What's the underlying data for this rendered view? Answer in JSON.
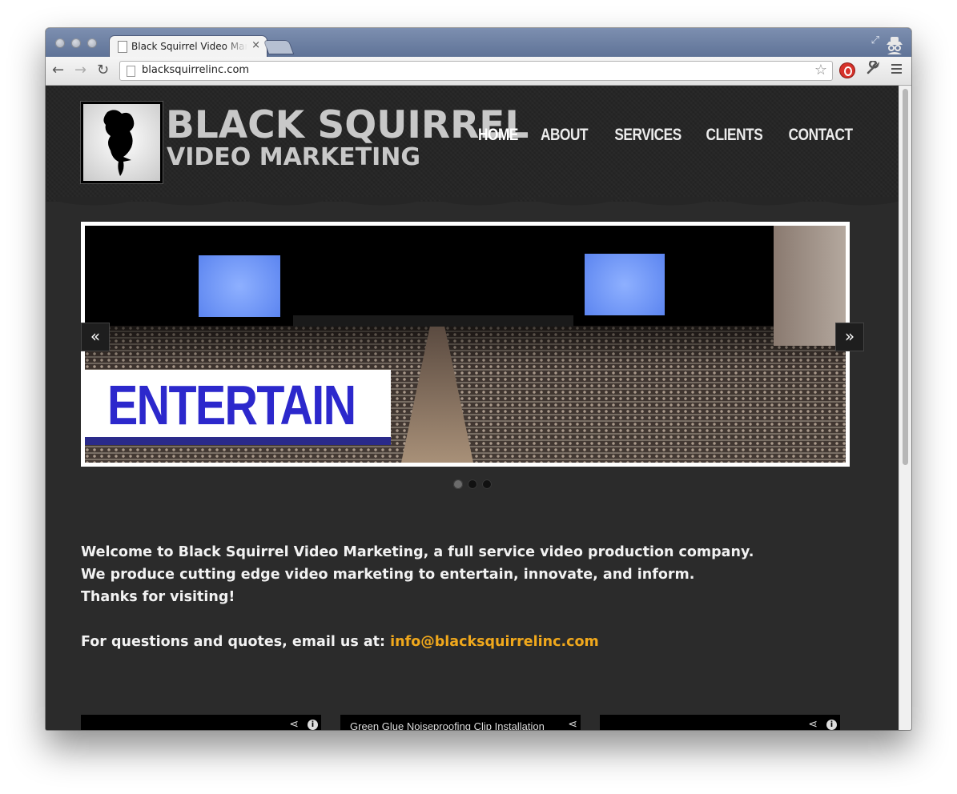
{
  "browser": {
    "tab_title": "Black Squirrel Video Marketing",
    "tab_close": "×",
    "url": "blacksquirrelinc.com",
    "back": "←",
    "forward": "→",
    "reload": "↻",
    "star": "☆",
    "wrench": "🔧",
    "expand": "⤢"
  },
  "site": {
    "logo_line1": "BLACK SQUIRREL",
    "logo_line2": "VIDEO MARKETING",
    "nav": [
      {
        "label": "HOME"
      },
      {
        "label": "ABOUT"
      },
      {
        "label": "SERVICES"
      },
      {
        "label": "CLIENTS"
      },
      {
        "label": "CONTACT"
      }
    ],
    "slider": {
      "caption": "ENTERTAIN",
      "prev": "«",
      "next": "»",
      "slide_count": 3,
      "active_slide": 1
    },
    "intro": {
      "line1": "Welcome to Black Squirrel Video Marketing, a full service video production company.",
      "line2": "We produce cutting edge video marketing to entertain, innovate, and inform.",
      "line3": "Thanks for visiting!",
      "email_prefix": "For questions and quotes, email us at: ",
      "email": "info@blacksquirrelinc.com"
    },
    "videos": [
      {
        "title": ""
      },
      {
        "title": "Green Glue Noiseproofing Clip Installation"
      },
      {
        "title": ""
      }
    ]
  },
  "colors": {
    "accent_link": "#f0a81c",
    "caption_blue": "#2c28cc",
    "page_bg": "#2b2b2b"
  }
}
